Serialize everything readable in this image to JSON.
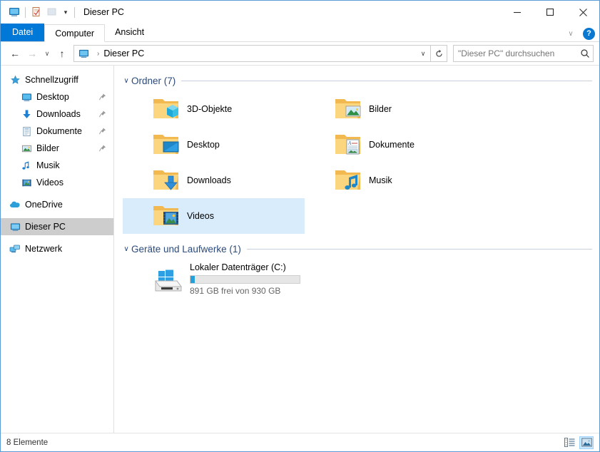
{
  "window": {
    "title": "Dieser PC",
    "quick_access": [
      {
        "name": "this-pc-icon",
        "label": "Dieser PC"
      },
      {
        "name": "properties-icon",
        "label": "Eigenschaften"
      },
      {
        "name": "new-folder-icon",
        "label": "Neuer Ordner"
      }
    ],
    "qat_dropdown": "▾",
    "controls": {
      "minimize": "—",
      "maximize": "☐",
      "close": "✕"
    }
  },
  "ribbon": {
    "tabs": [
      {
        "label": "Datei",
        "state": "file"
      },
      {
        "label": "Computer",
        "state": "active"
      },
      {
        "label": "Ansicht",
        "state": "normal"
      }
    ],
    "collapse_chevron": "∨",
    "help_label": "?"
  },
  "addressbar": {
    "back": "←",
    "forward": "→",
    "recent": "∨",
    "up": "↑",
    "breadcrumb_icon": "this-pc-icon",
    "breadcrumb": "Dieser PC",
    "separator": "›",
    "dropdown": "∨",
    "refresh": "↻"
  },
  "search": {
    "placeholder": "\"Dieser PC\" durchsuchen",
    "value": ""
  },
  "sidebar": {
    "items": [
      {
        "label": "Schnellzugriff",
        "icon": "star-icon",
        "level": "root",
        "pinned": false,
        "selected": false
      },
      {
        "label": "Desktop",
        "icon": "desktop-icon",
        "level": "child",
        "pinned": true,
        "selected": false
      },
      {
        "label": "Downloads",
        "icon": "downloads-icon",
        "level": "child",
        "pinned": true,
        "selected": false
      },
      {
        "label": "Dokumente",
        "icon": "documents-icon",
        "level": "child",
        "pinned": true,
        "selected": false
      },
      {
        "label": "Bilder",
        "icon": "pictures-icon",
        "level": "child",
        "pinned": true,
        "selected": false
      },
      {
        "label": "Musik",
        "icon": "music-icon",
        "level": "child",
        "pinned": false,
        "selected": false
      },
      {
        "label": "Videos",
        "icon": "videos-icon",
        "level": "child",
        "pinned": false,
        "selected": false
      },
      {
        "label": "OneDrive",
        "icon": "onedrive-icon",
        "level": "root",
        "pinned": false,
        "selected": false
      },
      {
        "label": "Dieser PC",
        "icon": "this-pc-icon",
        "level": "root",
        "pinned": false,
        "selected": true
      },
      {
        "label": "Netzwerk",
        "icon": "network-icon",
        "level": "root",
        "pinned": false,
        "selected": false
      }
    ]
  },
  "main": {
    "groups": [
      {
        "title": "Ordner (7)",
        "chevron": "∨",
        "items": [
          {
            "label": "3D-Objekte",
            "icon": "folder-3d-objects-icon",
            "selected": false
          },
          {
            "label": "Bilder",
            "icon": "folder-pictures-icon",
            "selected": false
          },
          {
            "label": "Desktop",
            "icon": "folder-desktop-icon",
            "selected": false
          },
          {
            "label": "Dokumente",
            "icon": "folder-documents-icon",
            "selected": false
          },
          {
            "label": "Downloads",
            "icon": "folder-downloads-icon",
            "selected": false
          },
          {
            "label": "Musik",
            "icon": "folder-music-icon",
            "selected": false
          },
          {
            "label": "Videos",
            "icon": "folder-videos-icon",
            "selected": true
          }
        ]
      }
    ],
    "devices_group": {
      "title": "Geräte und Laufwerke (1)",
      "chevron": "∨",
      "drives": [
        {
          "name": "Lokaler Datenträger (C:)",
          "icon": "hard-drive-windows-icon",
          "free_text": "891 GB frei von 930 GB",
          "used_percent": 4
        }
      ]
    }
  },
  "statusbar": {
    "item_count": "8 Elemente",
    "views": [
      {
        "name": "details-view-button",
        "active": false
      },
      {
        "name": "large-icons-view-button",
        "active": true
      }
    ]
  },
  "colors": {
    "accent": "#0078d7",
    "selection": "#d9ecfb",
    "nav_selection": "#cdcdcd",
    "group_header": "#2a4a7c",
    "folder_yellow": "#ffd076",
    "progress_fill": "#26a0da"
  }
}
